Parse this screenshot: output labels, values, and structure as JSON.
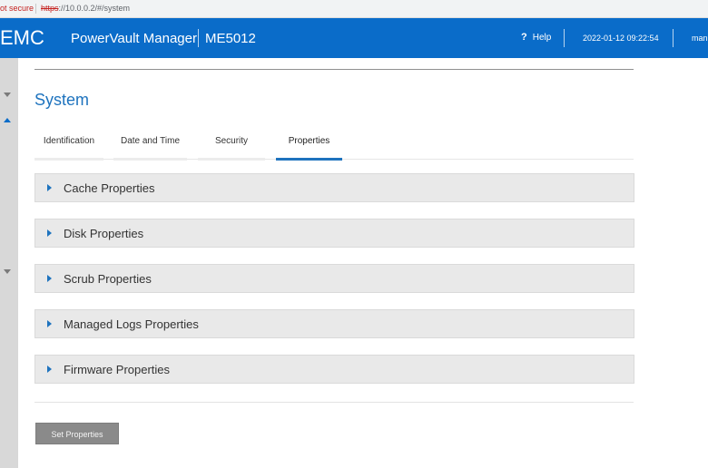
{
  "browser": {
    "security_label": "ot secure",
    "url_scheme": "https",
    "url_rest": "://10.0.0.2/#/system"
  },
  "header": {
    "brand": "EMC",
    "product": "PowerVault Manager",
    "model": "ME5012",
    "help_label": "Help",
    "datetime": "2022-01-12 09:22:54",
    "user": "man"
  },
  "page": {
    "title": "System"
  },
  "tabs": [
    {
      "label": "Identification",
      "active": false
    },
    {
      "label": "Date and Time",
      "active": false
    },
    {
      "label": "Security",
      "active": false
    },
    {
      "label": "Properties",
      "active": true
    }
  ],
  "sections": [
    {
      "label": "Cache Properties"
    },
    {
      "label": "Disk Properties"
    },
    {
      "label": "Scrub Properties"
    },
    {
      "label": "Managed Logs Properties"
    },
    {
      "label": "Firmware Properties"
    }
  ],
  "actions": {
    "set_properties_label": "Set Properties"
  },
  "colors": {
    "header_blue": "#0a6cc9",
    "accent_blue": "#1e73be",
    "button_gray": "#8a8a8a"
  }
}
